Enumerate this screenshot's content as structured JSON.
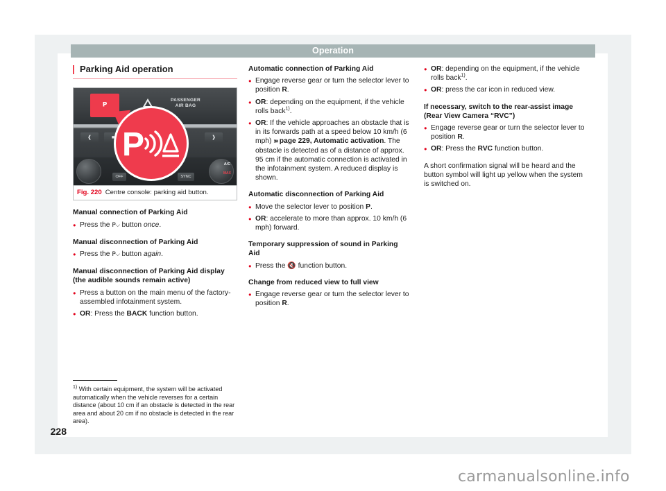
{
  "header": {
    "running_head": "Operation"
  },
  "page_number": "228",
  "watermark": "carmanualsonline.info",
  "heading": "Parking Aid operation",
  "figure": {
    "label": "Fig. 220",
    "caption": "Centre console: parking aid button.",
    "console_labels": {
      "parking_button": "P",
      "passenger_airbag_line1": "PASSENGER",
      "passenger_airbag_line2": "AIR BAG",
      "off": "OFF",
      "sync": "SYNC",
      "ac_max": "A/C",
      "ac_max_small": "MAX"
    }
  },
  "col1": {
    "s1_title": "Manual connection of Parking Aid",
    "s1_b1_pre": "Press the ",
    "s1_b1_mid": " button ",
    "s1_b1_em": "once",
    "s1_b1_post": ".",
    "s2_title": "Manual disconnection of Parking Aid",
    "s2_b1_pre": "Press the ",
    "s2_b1_mid": " button ",
    "s2_b1_em": "again",
    "s2_b1_post": ".",
    "s3_title_l1": "Manual disconnection of Parking Aid display",
    "s3_title_l2": "(the audible sounds remain active)",
    "s3_b1": "Press a button on the main menu of the factory-assembled infotainment system.",
    "s3_b2_or": "OR",
    "s3_b2_mid": ": Press the ",
    "s3_b2_bold": "BACK",
    "s3_b2_post": " function button."
  },
  "col2": {
    "s1_title": "Automatic connection of Parking Aid",
    "s1_b1_pre": "Engage reverse gear or turn the selector lever to position ",
    "s1_b1_bold": "R",
    "s1_b1_post": ".",
    "s1_b2_or": "OR",
    "s1_b2_text": ": depending on the equipment, if the vehicle rolls back",
    "s1_b2_sup": "1)",
    "s1_b2_post": ".",
    "s1_b3_or": "OR",
    "s1_b3_t1": ": If the vehicle approaches an obstacle that is in its forwards path at a speed below 10 km/h (6 mph) ",
    "s1_b3_arrows": "›››",
    "s1_b3_ref": " page 229, Automatic activation",
    "s1_b3_t2": ". The obstacle is detected as of a distance of approx. 95 cm if the automatic connection is activated in the infotainment system. A reduced display is shown.",
    "s2_title": "Automatic disconnection of Parking Aid",
    "s2_b1_pre": "Move the selector lever to position ",
    "s2_b1_bold": "P",
    "s2_b1_post": ".",
    "s2_b2_or": "OR",
    "s2_b2_text": ": accelerate to more than approx. 10 km/h (6 mph) forward.",
    "s3_title_l1": "Temporary suppression of sound in Parking",
    "s3_title_l2": "Aid",
    "s3_b1_pre": "Press the ",
    "s3_b1_post": " function button.",
    "s4_title": "Change from reduced view to full view",
    "s4_b1_pre": "Engage reverse gear or turn the selector lever to position ",
    "s4_b1_bold": "R",
    "s4_b1_post": "."
  },
  "col3": {
    "b1_or": "OR",
    "b1_text": ": depending on the equipment, if the vehicle rolls back",
    "b1_sup": "1)",
    "b1_post": ".",
    "b2_or": "OR",
    "b2_text": ": press the car icon in reduced view.",
    "s1_title_l1": "If necessary, switch to the rear-assist image",
    "s1_title_l2": "(Rear View Camera “RVC”)",
    "s1_b1_pre": "Engage reverse gear or turn the selector lever to position ",
    "s1_b1_bold": "R",
    "s1_b1_post": ".",
    "s1_b2_or": "OR",
    "s1_b2_mid": ": Press the ",
    "s1_b2_bold": "RVC",
    "s1_b2_post": " function button.",
    "closing_para": "A short confirmation signal will be heard and the button symbol will light up yellow when the system is switched on."
  },
  "footnote": {
    "marker": "1)",
    "text": " With certain equipment, the system will be activated automatically when the vehicle reverses for a certain distance (about 10 cm if an obstacle is detected in the rear area and about 20 cm if no obstacle is detected in the rear area)."
  },
  "colors": {
    "header_bar": "#a6b4b4",
    "accent_red": "#e2001a",
    "heading_rule": "#f7a3ab",
    "page_band": "#eef1f2"
  }
}
